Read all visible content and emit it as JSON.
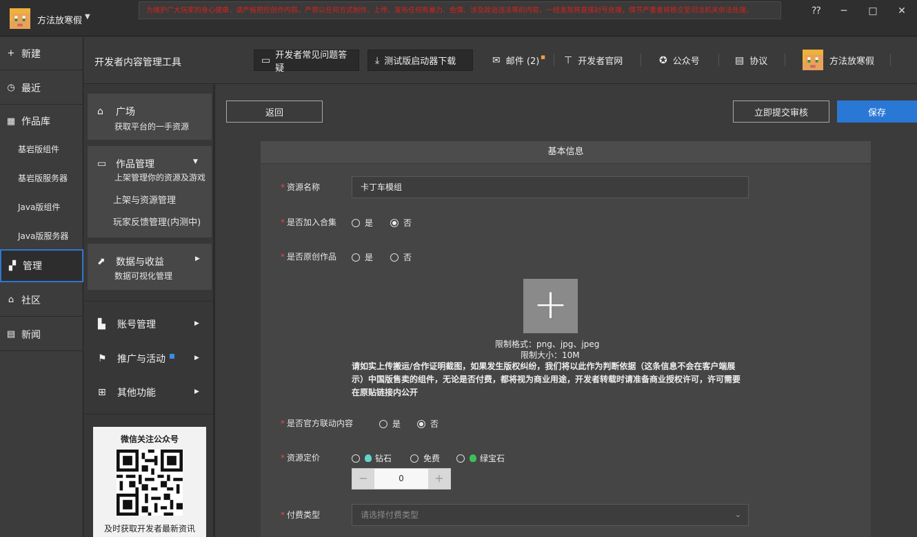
{
  "titlebar": {
    "username": "方法放寒假",
    "notice": "为维护广大玩家的身心健康，请严格把控创作内容。严禁以任何方式制作、上传、发布任何有暴力、色情、涉及政治违法等的内容，一经发现将直接封号处理，情节严重者将移交至司法机关依法处理。",
    "window_controls": [
      "⁇",
      "─",
      "□",
      "✕"
    ]
  },
  "leftnav": {
    "items": [
      {
        "label": "新建",
        "icon": "+"
      },
      {
        "label": "最近",
        "icon": "◷"
      },
      {
        "label": "作品库",
        "icon": "▦"
      },
      {
        "label": "基岩版组件"
      },
      {
        "label": "基岩版服务器"
      },
      {
        "label": "Java版组件"
      },
      {
        "label": "Java版服务器"
      },
      {
        "label": "管理",
        "icon": "▞"
      },
      {
        "label": "社区",
        "icon": "⌂"
      },
      {
        "label": "新闻",
        "icon": "▤"
      }
    ]
  },
  "toolbar": {
    "title": "开发者内容管理工具",
    "faq": "开发者常见问题答疑",
    "download": "测试版启动器下载",
    "mail": "邮件 (2)",
    "website": "开发者官网",
    "wechat": "公众号",
    "protocol": "协议",
    "username": "方法放寒假"
  },
  "menu2": {
    "plaza_title": "广场",
    "plaza_sub": "获取平台的一手资源",
    "works_title": "作品管理",
    "works_sub": "上架管理你的资源及游戏",
    "works_item1": "上架与资源管理",
    "works_item2": "玩家反馈管理(内测中)",
    "data_title": "数据与收益",
    "data_sub": "数据可视化管理",
    "account": "账号管理",
    "promo": "推广与活动",
    "other": "其他功能",
    "wechat_title": "微信关注公众号",
    "wechat_sub": "及时获取开发者最新资讯"
  },
  "main": {
    "back": "返回",
    "submit": "立即提交审核",
    "save": "保存",
    "form_title": "基本信息",
    "name_label": "资源名称",
    "name_value": "卡丁车模组",
    "collection_label": "是否加入合集",
    "original_label": "是否原创作品",
    "yes": "是",
    "no": "否",
    "limit_format": "限制格式：png、jpg、jpeg",
    "limit_size": "限制大小：10M",
    "upload_notice": "请如实上传搬运/合作证明截图，如果发生版权纠纷，我们将以此作为判断依据（这条信息不会在客户端展示）中国版售卖的组件，无论是否付费，都将视为商业用途，开发者转载时请准备商业授权许可，许可需要在原贴链接内公开",
    "official_label": "是否官方联动内容",
    "price_label": "资源定价",
    "diamond": "钻石",
    "free": "免费",
    "emerald": "绿宝石",
    "price_value": "0",
    "pay_label": "付费类型",
    "pay_placeholder": "请选择付费类型"
  },
  "colors": {
    "accent": "#2a78d6",
    "required": "#e24a4a",
    "notice": "#d4231f"
  }
}
